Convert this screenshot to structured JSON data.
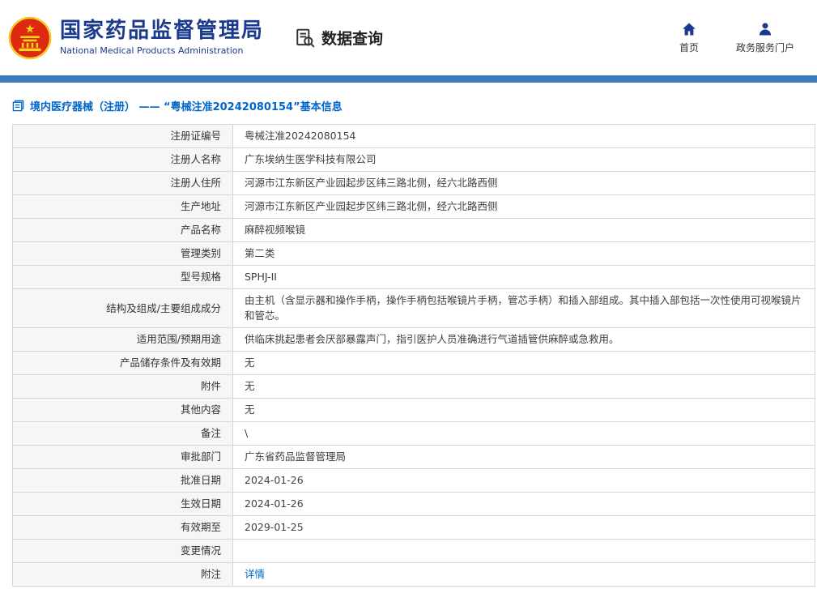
{
  "header": {
    "org_name_cn": "国家药品监督管理局",
    "org_name_en": "National Medical Products Administration",
    "data_query_label": "数据查询",
    "home_label": "首页",
    "portal_label": "政务服务门户"
  },
  "colors": {
    "brand_blue": "#1b3a8e",
    "bar_blue": "#3e7cbe",
    "link_blue": "#0066cc",
    "emblem_red": "#de2910",
    "emblem_gold": "#f7d617"
  },
  "breadcrumb": {
    "text": "境内医疗器械（注册） —— “粤械注准20242080154”基本信息"
  },
  "table": {
    "rows": [
      {
        "label": "注册证编号",
        "value": "粤械注准20242080154"
      },
      {
        "label": "注册人名称",
        "value": "广东埃纳生医学科技有限公司"
      },
      {
        "label": "注册人住所",
        "value": "河源市江东新区产业园起步区纬三路北侧，经六北路西侧"
      },
      {
        "label": "生产地址",
        "value": "河源市江东新区产业园起步区纬三路北侧，经六北路西侧"
      },
      {
        "label": "产品名称",
        "value": "麻醉视频喉镜"
      },
      {
        "label": "管理类别",
        "value": "第二类"
      },
      {
        "label": "型号规格",
        "value": "SPHJ-II"
      },
      {
        "label": "结构及组成/主要组成成分",
        "value": "由主机（含显示器和操作手柄，操作手柄包括喉镜片手柄，管芯手柄）和插入部组成。其中插入部包括一次性使用可视喉镜片和管芯。"
      },
      {
        "label": "适用范围/预期用途",
        "value": "供临床挑起患者会厌部暴露声门，指引医护人员准确进行气道插管供麻醉或急救用。"
      },
      {
        "label": "产品储存条件及有效期",
        "value": "无"
      },
      {
        "label": "附件",
        "value": "无"
      },
      {
        "label": "其他内容",
        "value": "无"
      },
      {
        "label": "备注",
        "value": "\\"
      },
      {
        "label": "审批部门",
        "value": "广东省药品监督管理局"
      },
      {
        "label": "批准日期",
        "value": "2024-01-26"
      },
      {
        "label": "生效日期",
        "value": "2024-01-26"
      },
      {
        "label": "有效期至",
        "value": "2029-01-25"
      },
      {
        "label": "变更情况",
        "value": ""
      },
      {
        "label": "附注",
        "value": "详情",
        "link": true
      }
    ]
  }
}
